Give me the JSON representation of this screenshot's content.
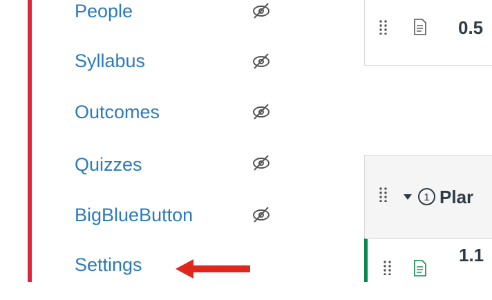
{
  "nav": {
    "items": [
      {
        "label": "People",
        "hidden_icon": "eye-slash-icon"
      },
      {
        "label": "Syllabus",
        "hidden_icon": "eye-slash-icon"
      },
      {
        "label": "Outcomes",
        "hidden_icon": "eye-slash-icon"
      },
      {
        "label": "Quizzes",
        "hidden_icon": "eye-slash-icon"
      },
      {
        "label": "BigBlueButton",
        "hidden_icon": "eye-slash-icon"
      },
      {
        "label": "Settings"
      }
    ],
    "accent_color": "#e0243a",
    "link_color": "#2b7abc"
  },
  "annotation": {
    "arrow_icon": "red-arrow-left-icon",
    "color": "#e0271d"
  },
  "modules": {
    "top_item": {
      "title": "0.5",
      "icon": "document-icon"
    },
    "module_header": {
      "number": "1",
      "title": "Plar",
      "icon": "caret-down-icon"
    },
    "module_item": {
      "title": "1.1",
      "icon": "document-icon",
      "published_color": "#0b874b"
    }
  }
}
